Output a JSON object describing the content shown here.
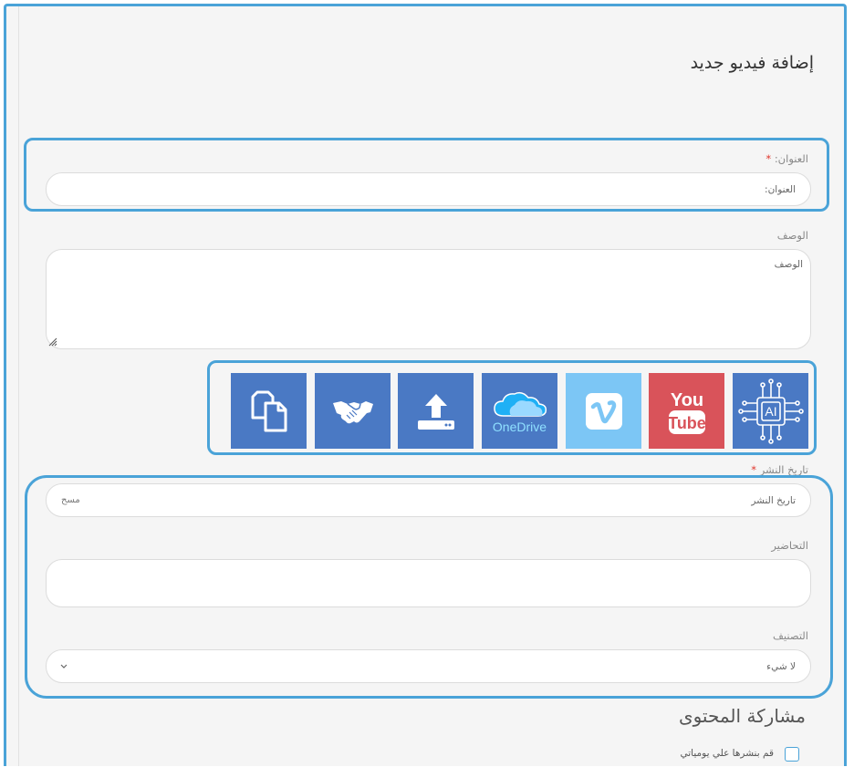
{
  "page": {
    "title": "إضافة فيديو جديد"
  },
  "title_field": {
    "label": "العنوان:",
    "required_mark": "*",
    "placeholder": "العنوان:"
  },
  "description_field": {
    "label": "الوصف",
    "placeholder": "الوصف"
  },
  "sources": [
    {
      "id": "ai",
      "icon": "ai-chip-icon",
      "label": "AI",
      "color": "#4a79c4"
    },
    {
      "id": "youtube",
      "icon": "youtube-icon",
      "label_top": "You",
      "label_bottom": "Tube",
      "color": "#d9535a"
    },
    {
      "id": "vimeo",
      "icon": "vimeo-icon",
      "color": "#7cc6f5"
    },
    {
      "id": "onedrive",
      "icon": "onedrive-icon",
      "label": "OneDrive",
      "color": "#4a79c4"
    },
    {
      "id": "upload",
      "icon": "upload-icon",
      "color": "#4a79c4"
    },
    {
      "id": "share",
      "icon": "handshake-icon",
      "color": "#4a79c4"
    },
    {
      "id": "copy",
      "icon": "copy-icon",
      "color": "#4a79c4"
    }
  ],
  "publish_date": {
    "label": "تاريخ النشر",
    "required_mark": "*",
    "placeholder": "تاريخ النشر",
    "clear_label": "مسح"
  },
  "preparations": {
    "label": "التحاضير"
  },
  "category": {
    "label": "التصنيف",
    "selected": "لا شيء"
  },
  "sharing": {
    "title": "مشاركة المحتوى",
    "publish_checkbox_label": "قم بنشرها علي يومياتي"
  }
}
